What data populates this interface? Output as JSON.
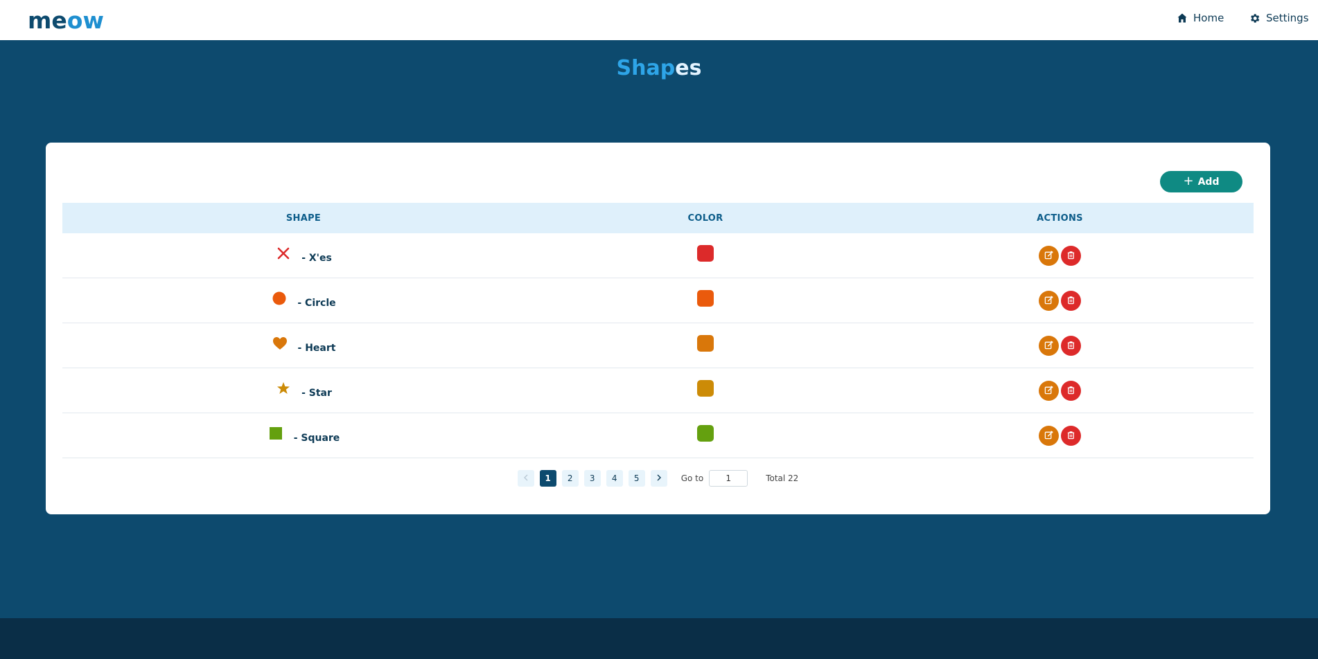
{
  "header": {
    "logo_part1": "me",
    "logo_part2": "ow",
    "nav": [
      {
        "label": "Home",
        "icon": "home-icon"
      },
      {
        "label": "Settings",
        "icon": "gear-icon"
      }
    ]
  },
  "page": {
    "title_part1": "Shap",
    "title_part2": "es"
  },
  "toolbar": {
    "add_label": "Add",
    "add_icon": "plus-icon"
  },
  "table": {
    "columns": [
      "SHAPE",
      "COLOR",
      "ACTIONS"
    ],
    "rows": [
      {
        "shape": "x",
        "label": "- X'es",
        "color": "#dc2a2a"
      },
      {
        "shape": "circle",
        "label": "- Circle",
        "color": "#ea5a0c"
      },
      {
        "shape": "heart",
        "label": "- Heart",
        "color": "#d9770a"
      },
      {
        "shape": "star",
        "label": "- Star",
        "color": "#cc8b07"
      },
      {
        "shape": "square",
        "label": "- Square",
        "color": "#64a00f"
      }
    ]
  },
  "pagination": {
    "pages": [
      "1",
      "2",
      "3",
      "4",
      "5"
    ],
    "current": "1",
    "goto_label": "Go to",
    "goto_value": "1",
    "total_text": "Total 22"
  }
}
